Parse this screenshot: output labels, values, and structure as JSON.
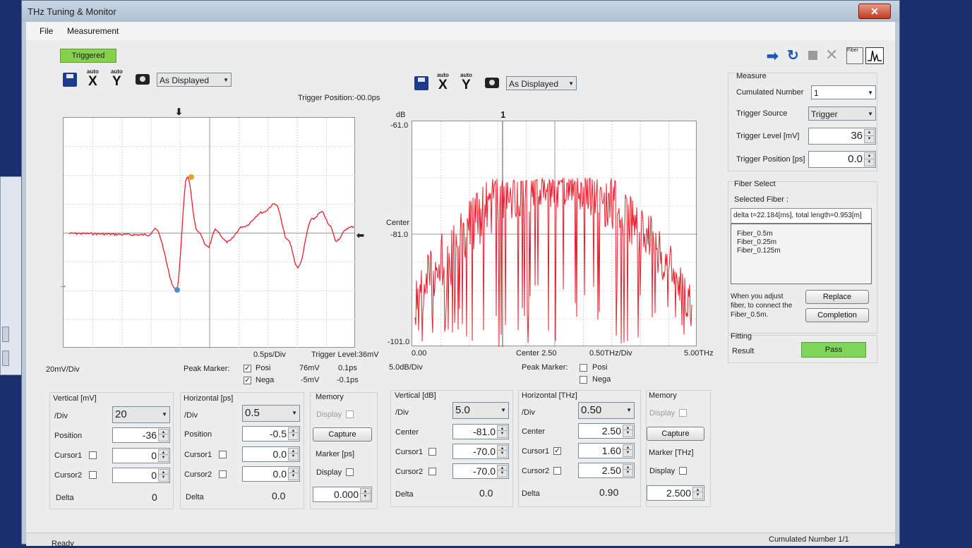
{
  "window": {
    "title": "THz Tuning & Monitor",
    "close_glyph": "✕"
  },
  "menu": [
    "File",
    "Measurement"
  ],
  "status": {
    "triggered": "Triggered",
    "left": "Ready",
    "right": "Cumulated Number 1/1"
  },
  "toolbar": {
    "auto": "auto",
    "x": "X",
    "y": "Y",
    "display_mode": "As Displayed"
  },
  "right_toolbar_icons": [
    "arrow-right-icon",
    "refresh-icon",
    "stop-icon",
    "cancel-x-icon",
    "fiber-icon",
    "waveform-icon"
  ],
  "fiber_icon_text": "Fiber",
  "time_chart": {
    "trigger_position_label": "Trigger Position:-00.0ps",
    "div_x": "0.5ps/Div",
    "trigger_level": "Trigger Level:36mV",
    "div_y": "20mV/Div",
    "peak_marker": {
      "title": "Peak Marker:",
      "posi": "Posi",
      "nega": "Nega",
      "posi_checked": true,
      "nega_checked": true,
      "posi_value": "76mV",
      "posi_time": "0.1ps",
      "nega_value": "-5mV",
      "nega_time": "-0.1ps"
    },
    "vertical": {
      "title": "Vertical [mV]",
      "div_label": "/Div",
      "div_value": "20",
      "position_label": "Position",
      "position_value": "-36",
      "cursor1_label": "Cursor1",
      "cursor1_value": "0",
      "cursor2_label": "Cursor2",
      "cursor2_value": "0",
      "delta_label": "Delta",
      "delta_value": "0"
    },
    "horizontal": {
      "title": "Horizontal [ps]",
      "div_label": "/Div",
      "div_value": "0.5",
      "position_label": "Position",
      "position_value": "-0.5",
      "cursor1_label": "Cursor1",
      "cursor1_value": "0.0",
      "cursor2_label": "Cursor2",
      "cursor2_value": "0.0",
      "delta_label": "Delta",
      "delta_value": "0.0"
    },
    "memory": {
      "title": "Memory",
      "display_label": "Display",
      "capture": "Capture",
      "marker_label": "Marker [ps]",
      "marker_display": "Display",
      "marker_value": "0.000"
    }
  },
  "freq_chart": {
    "y_unit": "dB",
    "y_top": "-61.0",
    "y_center_label": "Center",
    "y_center": "-81.0",
    "y_bottom": "-101.0",
    "marker_label": "1",
    "x_left": "0.00",
    "x_center": "Center  2.50",
    "div_x": "0.50THz/Div",
    "x_right": "5.00THz",
    "div_y": "5.0dB/Div",
    "peak_marker": {
      "title": "Peak Marker:",
      "posi": "Posi",
      "nega": "Nega",
      "posi_checked": false,
      "nega_checked": false
    },
    "vertical": {
      "title": "Vertical [dB]",
      "div_label": "/Div",
      "div_value": "5.0",
      "center_label": "Center",
      "center_value": "-81.0",
      "cursor1_label": "Cursor1",
      "cursor1_value": "-70.0",
      "cursor2_label": "Cursor2",
      "cursor2_value": "-70.0",
      "delta_label": "Delta",
      "delta_value": "0.0"
    },
    "horizontal": {
      "title": "Horizontal [THz]",
      "div_label": "/Div",
      "div_value": "0.50",
      "center_label": "Center",
      "center_value": "2.50",
      "cursor1_label": "Cursor1",
      "cursor1_value": "1.60",
      "cursor1_checked": true,
      "cursor2_label": "Cursor2",
      "cursor2_value": "2.50",
      "delta_label": "Delta",
      "delta_value": "0.90"
    },
    "memory": {
      "title": "Memory",
      "display_label": "Display",
      "capture": "Capture",
      "marker_label": "Marker [THz]",
      "marker_display": "Display",
      "marker_value": "2.500"
    }
  },
  "measure": {
    "title": "Measure",
    "cumulated_label": "Cumulated Number",
    "cumulated_value": "1",
    "trigger_source_label": "Trigger Source",
    "trigger_source_value": "Trigger",
    "trigger_level_label": "Trigger Level [mV]",
    "trigger_level_value": "36",
    "trigger_position_label": "Trigger Position [ps]",
    "trigger_position_value": "0.0"
  },
  "fiber": {
    "title": "Fiber Select",
    "selected_label": "Selected Fiber :",
    "selected_value": "delta t=22.184[ms], total length=0.953[m]",
    "items": [
      "Fiber_0.5m",
      "Fiber_0.25m",
      "Fiber_0.125m"
    ],
    "hint_line1": "When you adjust",
    "hint_line2": "fiber, to connect the",
    "hint_line3": "Fiber_0.5m.",
    "replace": "Replace",
    "completion": "Completion"
  },
  "fitting": {
    "title": "Fitting",
    "result_label": "Result",
    "result_value": "Pass"
  },
  "colors": {
    "trace": "#e8202e",
    "pass": "#7fd45a",
    "triggered": "#86d04b",
    "pos_marker": "#e9a12a",
    "neg_marker": "#4f8fc7"
  }
}
